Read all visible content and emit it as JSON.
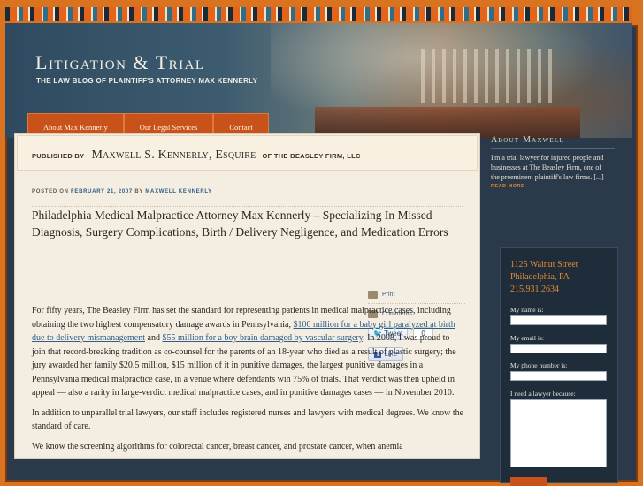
{
  "site": {
    "title": "Litigation & Trial",
    "subtitle": "THE LAW BLOG OF PLAINTIFF'S ATTORNEY MAX KENNERLY"
  },
  "nav": [
    "About Max Kennerly",
    "Our Legal Services",
    "Contact"
  ],
  "byline": {
    "prefix": "PUBLISHED BY",
    "name": "Maxwell S. Kennerly, Esquire",
    "suffix": "OF THE BEASLEY FIRM, LLC"
  },
  "post": {
    "meta_prefix": "POSTED ON",
    "date": "FEBRUARY 21, 2007",
    "meta_by": "BY",
    "author": "MAXWELL KENNERLY",
    "title": "Philadelphia Medical Malpractice Attorney Max Kennerly – Specializing In Missed Diagnosis, Surgery Complications, Birth / Delivery Negligence, and Medication Errors",
    "p1_a": "For fifty years, The Beasley Firm has set the standard for representing patients in medical malpractice cases, including obtaining the two highest compensatory damage awards in Pennsylvania,",
    "p1_link1": "$100 million for a baby girl paralyzed at birth due to delivery mismanagement",
    "p1_and": "and",
    "p1_link2": "$55 million for a boy brain damaged by vascular surgery",
    "p1_b": ". In 2008, I was proud to join that record-breaking tradition as co-counsel for the parents of an 18-year who died as a result of plastic surgery; the jury awarded her family $20.5 million, $15 million of it in punitive damages, the largest punitive damages in a Pennsylvania medical malpractice case, in a venue where defendants win 75% of trials. That verdict was then upheld in appeal — also a rarity in large-verdict medical malpractice cases, and in punitive damages cases — in November 2010.",
    "p2": "In addition to unparallel trial lawyers, our staff includes registered nurses and lawyers with medical degrees. We know the standard of care.",
    "p3": "We know the screening algorithms for colorectal cancer, breast cancer, and prostate cancer, when anemia"
  },
  "share": {
    "print": "Print",
    "comments": "Comments",
    "tweet": "Tweet",
    "tweet_count": "0",
    "like": "Like"
  },
  "sidebar": {
    "about_heading": "About Maxwell",
    "about_text": "I'm a trial lawyer for injured people and businesses at The Beasley Firm, one of the preeminent plaintiff's law firms. [...]",
    "read_more": "READ MORE",
    "address": [
      "1125 Walnut Street",
      "Philadelphia, PA",
      "215.931.2634"
    ],
    "form": {
      "name_label": "My name is:",
      "email_label": "My email is:",
      "phone_label": "My phone number is:",
      "need_label": "I need a lawyer because:"
    }
  },
  "colors": {
    "background": "#d9731f",
    "nav_tab": "#c8521a",
    "link": "#2e5d86",
    "accent": "#e88a30"
  }
}
